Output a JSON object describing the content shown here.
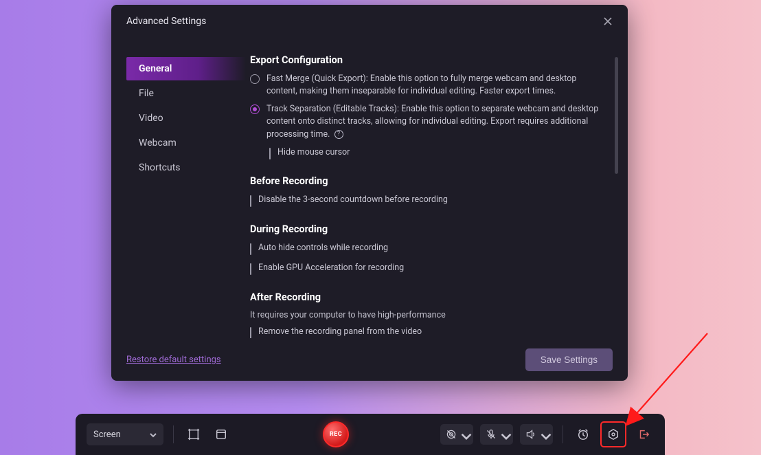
{
  "modal": {
    "title": "Advanced Settings",
    "sidebar": {
      "items": [
        {
          "label": "General"
        },
        {
          "label": "File"
        },
        {
          "label": "Video"
        },
        {
          "label": "Webcam"
        },
        {
          "label": "Shortcuts"
        }
      ],
      "active_index": 0
    },
    "sections": {
      "export": {
        "heading": "Export Configuration",
        "opt_fast": "Fast Merge (Quick Export): Enable this option to fully merge webcam and desktop content, making them inseparable for individual editing. Faster export times.",
        "opt_track": "Track Separation (Editable Tracks): Enable this option to separate webcam and desktop content onto distinct tracks, allowing for individual editing. Export requires additional processing time.",
        "hide_cursor": "Hide mouse cursor"
      },
      "before": {
        "heading": "Before Recording",
        "disable_countdown": "Disable the 3-second countdown before recording"
      },
      "during": {
        "heading": "During Recording",
        "auto_hide": "Auto hide controls while recording",
        "gpu": "Enable GPU Acceleration for recording"
      },
      "after": {
        "heading": "After Recording",
        "note": "It requires your computer to have high-performance",
        "remove_panel": "Remove the recording panel from the video"
      }
    },
    "footer": {
      "restore": "Restore default settings",
      "save": "Save Settings"
    }
  },
  "toolbar": {
    "screen_label": "Screen",
    "rec_label": "REC"
  }
}
